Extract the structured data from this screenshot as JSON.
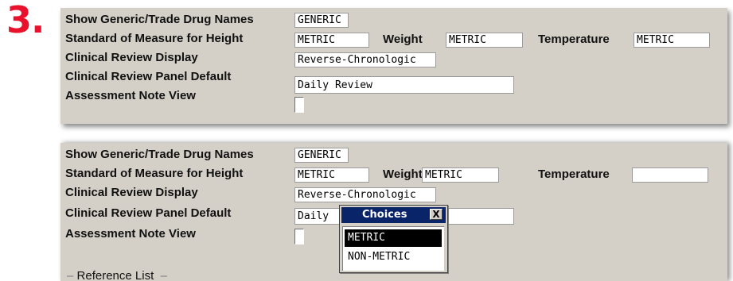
{
  "step_number": "3.",
  "panel1": {
    "generic_label": "Show Generic/Trade Drug Names",
    "generic_value": "GENERIC",
    "height_label": "Standard of Measure for Height",
    "height_value": "METRIC",
    "weight_label": "Weight",
    "weight_value": "METRIC",
    "temp_label": "Temperature",
    "temp_value": "METRIC",
    "review_display_label": "Clinical Review Display",
    "review_display_value": "Reverse-Chronologic",
    "panel_default_label": "Clinical Review Panel Default",
    "panel_default_value": "Daily Review",
    "assessment_label": "Assessment Note View"
  },
  "panel2": {
    "generic_label": "Show Generic/Trade Drug Names",
    "generic_value": "GENERIC",
    "height_label": "Standard of Measure for Height",
    "height_value": "METRIC",
    "weight_label": "Weight",
    "weight_value": "METRIC",
    "temp_label": "Temperature",
    "temp_value": "",
    "review_display_label": "Clinical Review Display",
    "review_display_value": "Reverse-Chronologic",
    "panel_default_label": "Clinical Review Panel Default",
    "panel_default_value": "Daily",
    "assessment_label": "Assessment Note View",
    "reference_label": "Reference List"
  },
  "choices_popup": {
    "title": "Choices",
    "close": "X",
    "options": [
      "METRIC",
      "NON-METRIC"
    ],
    "selected_index": 0
  }
}
